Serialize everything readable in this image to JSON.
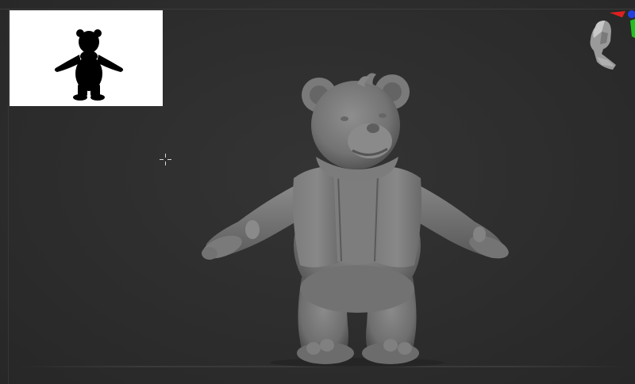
{
  "viewport": {
    "background": "#2d2d2d",
    "model_color": "#808080"
  },
  "thumbnail": {
    "background": "#ffffff",
    "silhouette_color": "#000000"
  },
  "navigator": {
    "axis_colors": {
      "x": "#e02020",
      "y": "#20c020",
      "z": "#2040e0"
    }
  }
}
